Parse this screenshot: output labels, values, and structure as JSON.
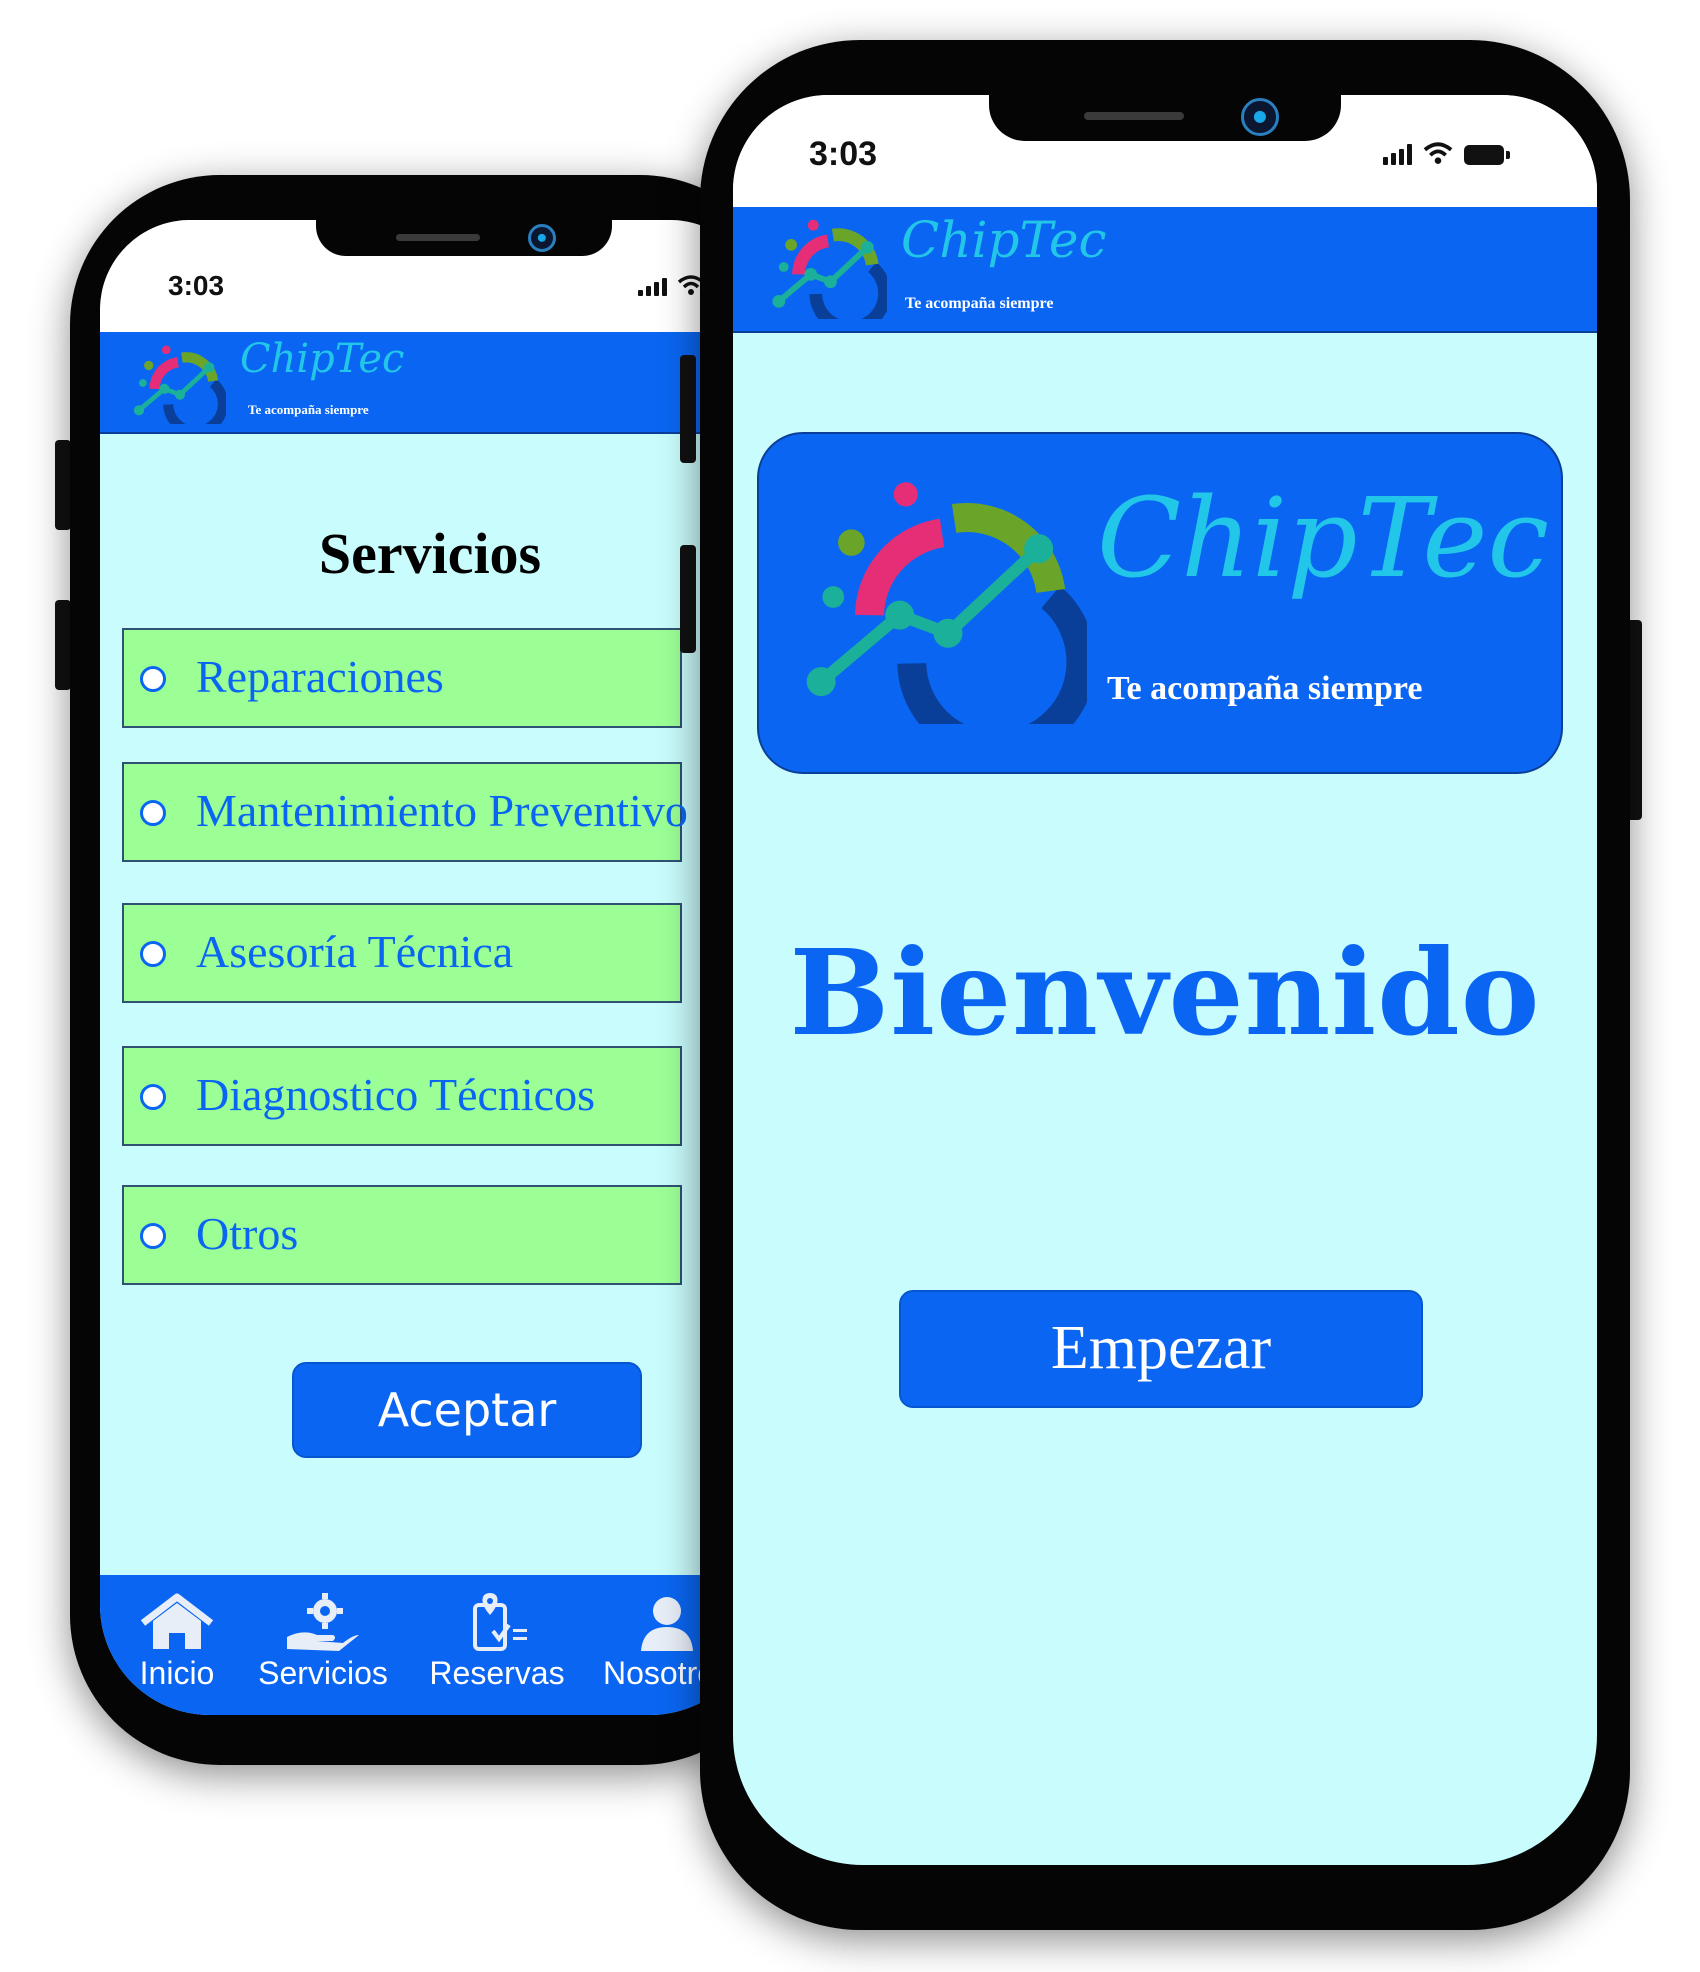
{
  "left_phone": {
    "status_time": "3:03",
    "brand": {
      "name": "ChipTec",
      "tagline": "Te acompaña siempre"
    },
    "title": "Servicios",
    "options": [
      {
        "label": "Reparaciones"
      },
      {
        "label": "Mantenimiento Preventivo"
      },
      {
        "label": "Asesoría Técnica"
      },
      {
        "label": "Diagnostico Técnicos"
      },
      {
        "label": "Otros"
      }
    ],
    "accept_label": "Aceptar",
    "tabs": [
      {
        "label": "Inicio",
        "icon": "home-icon"
      },
      {
        "label": "Servicios",
        "icon": "hand-gear-icon"
      },
      {
        "label": "Reservas",
        "icon": "reservation-icon"
      },
      {
        "label": "Nosotros",
        "icon": "person-icon"
      }
    ]
  },
  "right_phone": {
    "status_time": "3:03",
    "brand": {
      "name": "ChipTec",
      "tagline": "Te acompaña siempre"
    },
    "welcome": "Bienvenido",
    "start_label": "Empezar"
  },
  "colors": {
    "primary": "#0a66f2",
    "screen_bg": "#c9fcfc",
    "option_bg": "#9bff96",
    "brand_cyan": "#21c6e8"
  }
}
